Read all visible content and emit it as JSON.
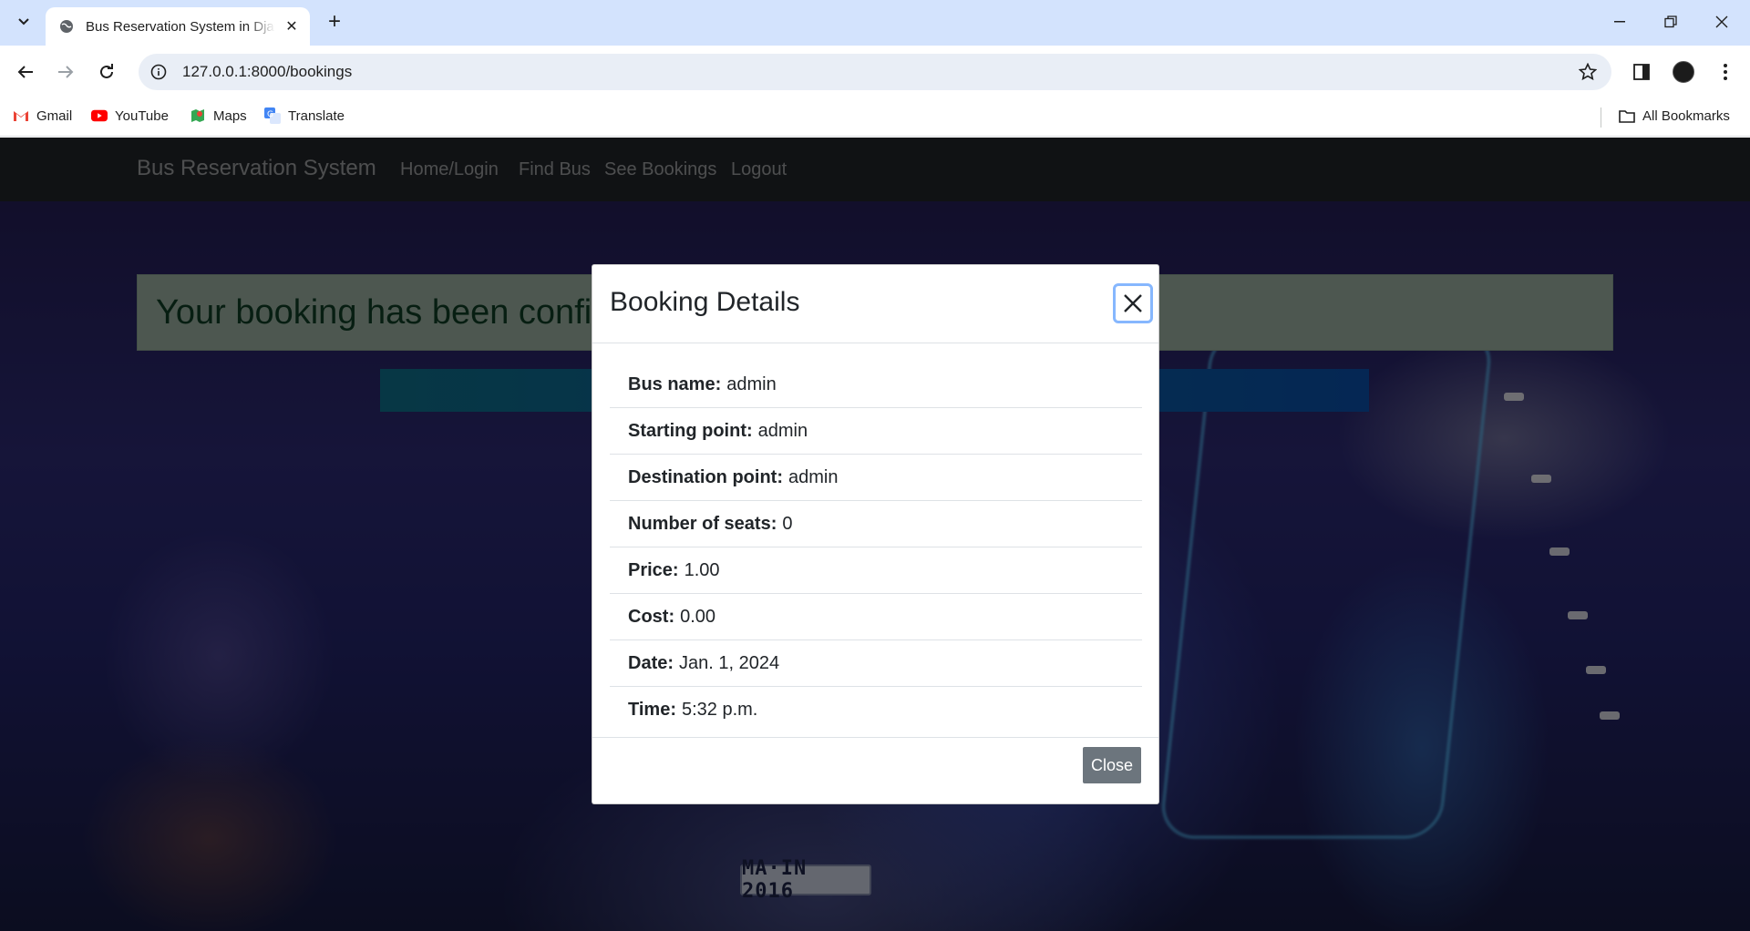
{
  "browser": {
    "tab_title": "Bus Reservation System in Django",
    "url": "127.0.0.1:8000/bookings",
    "bookmarks": [
      {
        "label": "Gmail",
        "icon": "gmail-icon"
      },
      {
        "label": "YouTube",
        "icon": "youtube-icon"
      },
      {
        "label": "Maps",
        "icon": "maps-icon"
      },
      {
        "label": "Translate",
        "icon": "translate-icon"
      }
    ],
    "all_bookmarks": "All Bookmarks",
    "colors": {
      "tabbar": "#d3e3fd",
      "omnibox": "#e9eef6"
    }
  },
  "navbar": {
    "brand": "Bus Reservation System",
    "links": [
      "Home/Login",
      "Find Bus",
      "See Bookings",
      "Logout"
    ]
  },
  "alert": {
    "text": "Your booking has been confirmed"
  },
  "background": {
    "plate_text": "MA·IN 2016"
  },
  "modal": {
    "title": "Booking Details",
    "close_button": "Close",
    "details": [
      {
        "label": "Bus name:",
        "value": "admin"
      },
      {
        "label": "Starting point:",
        "value": "admin"
      },
      {
        "label": "Destination point:",
        "value": "admin"
      },
      {
        "label": "Number of seats:",
        "value": "0"
      },
      {
        "label": "Price:",
        "value": "1.00"
      },
      {
        "label": "Cost:",
        "value": "0.00"
      },
      {
        "label": "Date:",
        "value": "Jan. 1, 2024"
      },
      {
        "label": "Time:",
        "value": "5:32 p.m."
      }
    ]
  }
}
